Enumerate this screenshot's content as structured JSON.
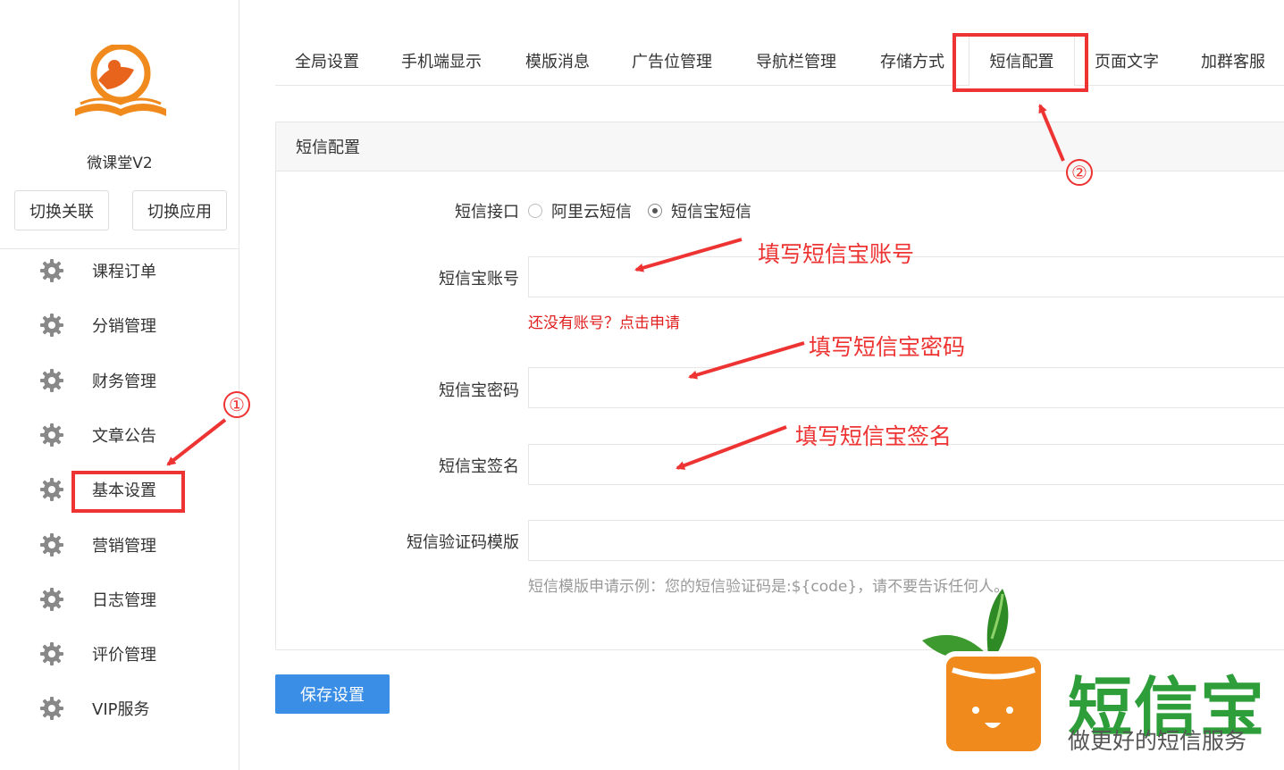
{
  "sidebar": {
    "app_name": "微课堂V2",
    "switch_link_label": "切换关联",
    "switch_app_label": "切换应用",
    "items": [
      {
        "label": "课程订单",
        "icon": "gear-icon"
      },
      {
        "label": "分销管理",
        "icon": "gear-icon"
      },
      {
        "label": "财务管理",
        "icon": "gear-icon"
      },
      {
        "label": "文章公告",
        "icon": "gear-icon"
      },
      {
        "label": "基本设置",
        "icon": "gear-icon"
      },
      {
        "label": "营销管理",
        "icon": "gear-icon"
      },
      {
        "label": "日志管理",
        "icon": "gear-icon"
      },
      {
        "label": "评价管理",
        "icon": "gear-icon"
      },
      {
        "label": "VIP服务",
        "icon": "gear-icon"
      }
    ]
  },
  "tabs": [
    {
      "label": "全局设置"
    },
    {
      "label": "手机端显示"
    },
    {
      "label": "模版消息"
    },
    {
      "label": "广告位管理"
    },
    {
      "label": "导航栏管理"
    },
    {
      "label": "存储方式"
    },
    {
      "label": "短信配置",
      "active": true
    },
    {
      "label": "页面文字"
    },
    {
      "label": "加群客服"
    }
  ],
  "panel": {
    "title": "短信配置",
    "interface_label": "短信接口",
    "interface_options": [
      {
        "label": "阿里云短信",
        "checked": false
      },
      {
        "label": "短信宝短信",
        "checked": true
      }
    ],
    "account_label": "短信宝账号",
    "account_value": "",
    "signup_link": "还没有账号？点击申请",
    "password_label": "短信宝密码",
    "password_value": "",
    "signature_label": "短信宝签名",
    "signature_value": "",
    "template_label": "短信验证码模版",
    "template_value": "",
    "template_hint": "短信模版申请示例：您的短信验证码是:${code}，请不要告诉任何人。"
  },
  "save_label": "保存设置",
  "annotations": {
    "step1": "①",
    "step2": "②",
    "fill_account": "填写短信宝账号",
    "fill_password": "填写短信宝密码",
    "fill_signature": "填写短信宝签名",
    "highlight_color": "#ee3333"
  },
  "brand": {
    "title": "短信宝",
    "slogan": "做更好的短信服务",
    "green": "#2e9e3a",
    "orange": "#f08a1c"
  },
  "colors": {
    "primary_button": "#3a8ee6",
    "link_red": "#e02020",
    "border": "#e6e6e6"
  }
}
